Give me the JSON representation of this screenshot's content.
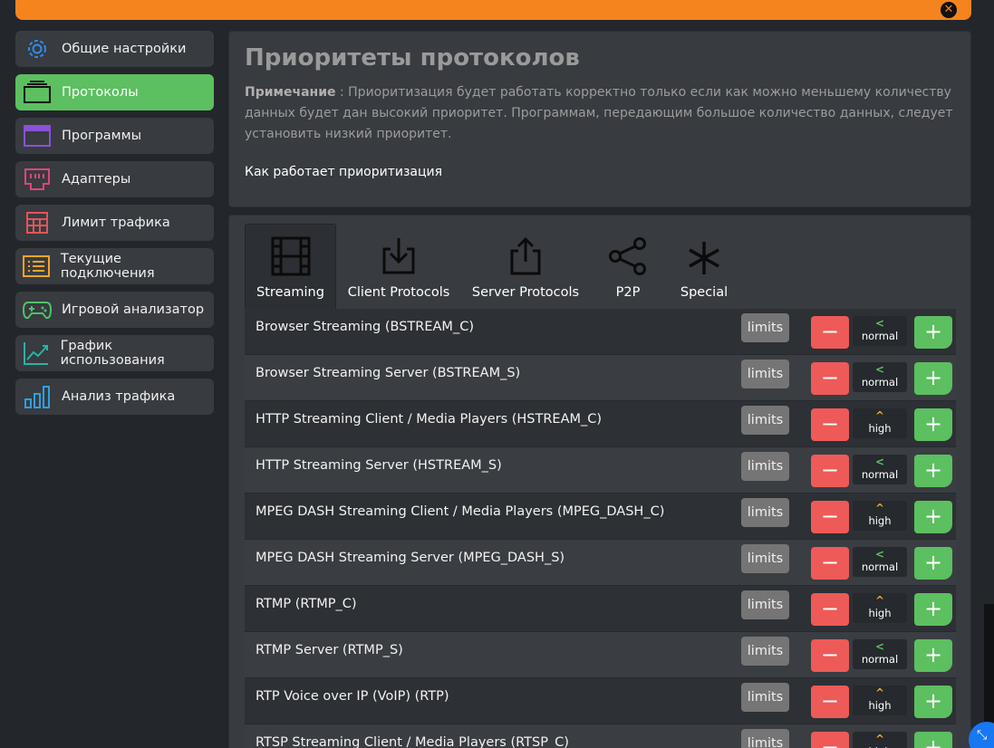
{
  "topbar": {
    "close_icon": "close-icon"
  },
  "sidebar": {
    "items": [
      {
        "label": "Общие настройки",
        "icon": "gear-icon",
        "active": false
      },
      {
        "label": "Протоколы",
        "icon": "protocol-icon",
        "active": true
      },
      {
        "label": "Программы",
        "icon": "window-icon",
        "active": false
      },
      {
        "label": "Адаптеры",
        "icon": "ethernet-icon",
        "active": false
      },
      {
        "label": "Лимит трафика",
        "icon": "grid-icon",
        "active": false
      },
      {
        "label": "Текущие подключения",
        "icon": "list-icon",
        "active": false
      },
      {
        "label": "Игровой анализатор",
        "icon": "gamepad-icon",
        "active": false
      },
      {
        "label": "График использования",
        "icon": "chart-line-icon",
        "active": false
      },
      {
        "label": "Анализ трафика",
        "icon": "bar-chart-icon",
        "active": false
      }
    ]
  },
  "header": {
    "title": "Приоритеты протоколов",
    "note_label": "Примечание",
    "note_sep": " : ",
    "note_text": "Приоритизация будет работать корректно только если как можно меньшему количеству данных будет дан высокий приоритет. Программам, передающим большое количество данных, следует установить низкий приоритет.",
    "how_link": "Как работает приоритизация"
  },
  "tabs": [
    {
      "label": "Streaming",
      "icon": "film-icon",
      "active": true
    },
    {
      "label": "Client Protocols",
      "icon": "download-icon",
      "active": false
    },
    {
      "label": "Server Protocols",
      "icon": "upload-icon",
      "active": false
    },
    {
      "label": "P2P",
      "icon": "share-icon",
      "active": false
    },
    {
      "label": "Special",
      "icon": "asterisk-icon",
      "active": false
    }
  ],
  "row_controls": {
    "limits_label": "limits",
    "minus_label": "−",
    "plus_label": "+"
  },
  "protocols": [
    {
      "name": "Browser Streaming (BSTREAM_C)",
      "priority": "normal"
    },
    {
      "name": "Browser Streaming Server (BSTREAM_S)",
      "priority": "normal"
    },
    {
      "name": "HTTP Streaming Client / Media Players (HSTREAM_C)",
      "priority": "high"
    },
    {
      "name": "HTTP Streaming Server (HSTREAM_S)",
      "priority": "normal"
    },
    {
      "name": "MPEG DASH Streaming Client / Media Players (MPEG_DASH_C)",
      "priority": "high"
    },
    {
      "name": "MPEG DASH Streaming Server (MPEG_DASH_S)",
      "priority": "normal"
    },
    {
      "name": "RTMP (RTMP_C)",
      "priority": "high"
    },
    {
      "name": "RTMP Server (RTMP_S)",
      "priority": "normal"
    },
    {
      "name": "RTP Voice over IP (VoIP) (RTP)",
      "priority": "high"
    },
    {
      "name": "RTSP Streaming Client / Media Players (RTSP_C)",
      "priority": "high"
    }
  ],
  "colors": {
    "accent_orange": "#f5841f",
    "active_green": "#5cbf60",
    "minus_red": "#ee5a57",
    "fab_blue": "#1877f2"
  }
}
